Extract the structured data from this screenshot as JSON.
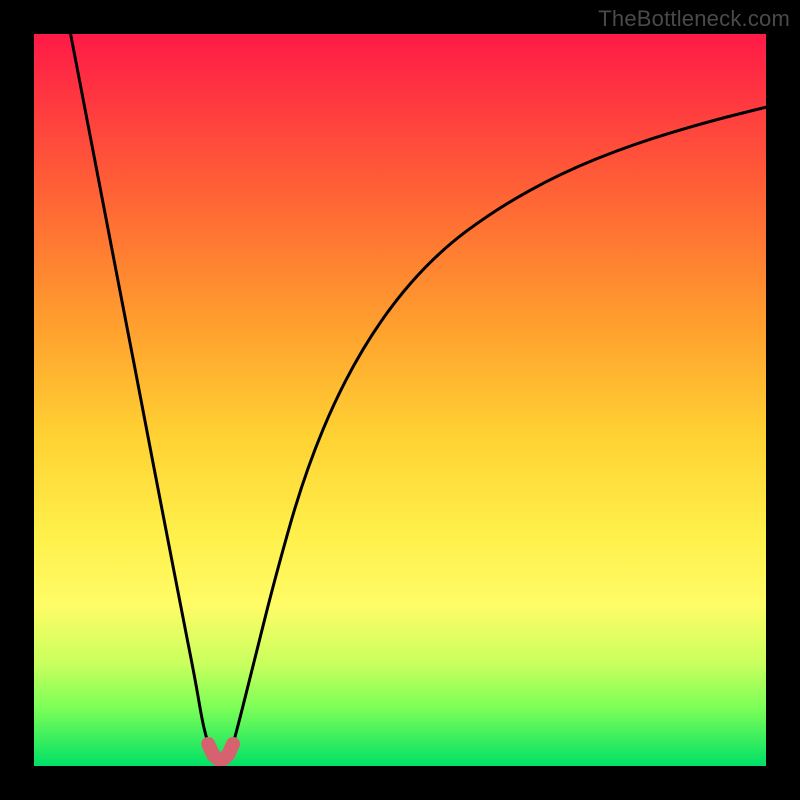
{
  "watermark": "TheBottleneck.com",
  "colors": {
    "frame": "#000000",
    "curve_stroke": "#000000",
    "marker_stroke": "#d6626f",
    "gradient_top": "#ff1a47",
    "gradient_bottom": "#00e066"
  },
  "chart_data": {
    "type": "line",
    "title": "",
    "xlabel": "",
    "ylabel": "",
    "xlim": [
      0,
      100
    ],
    "ylim": [
      0,
      100
    ],
    "grid": false,
    "series": [
      {
        "name": "left-branch",
        "x": [
          5,
          7.5,
          10,
          12.5,
          15,
          17.5,
          20,
          22,
          23,
          23.8
        ],
        "y": [
          100,
          87,
          74,
          61,
          48,
          35,
          22,
          12,
          6,
          3
        ]
      },
      {
        "name": "right-branch",
        "x": [
          27.2,
          28,
          30,
          33,
          37,
          42,
          48,
          55,
          63,
          72,
          82,
          92,
          100
        ],
        "y": [
          3,
          6,
          14,
          26,
          40,
          52,
          62,
          70,
          76,
          81,
          85,
          88,
          90
        ]
      },
      {
        "name": "minimum-markers",
        "x": [
          23.8,
          24.5,
          25.2,
          25.8,
          26.5,
          27.2
        ],
        "y": [
          3,
          1.5,
          0.9,
          0.9,
          1.5,
          3
        ]
      }
    ],
    "annotations": []
  }
}
